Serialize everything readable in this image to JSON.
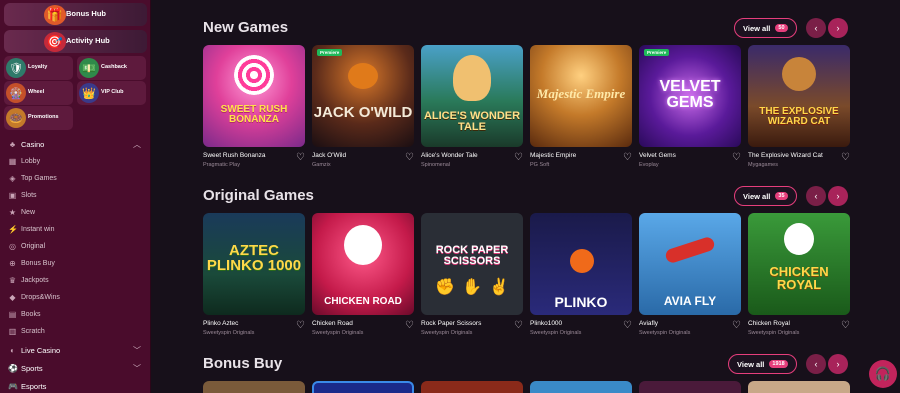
{
  "sidebar": {
    "hubs": [
      {
        "label": "Bonus Hub",
        "icon": "gift-icon"
      },
      {
        "label": "Activity Hub",
        "icon": "target-icon"
      }
    ],
    "tiles": [
      {
        "label": "Loyalty",
        "icon": "shield-icon"
      },
      {
        "label": "Cashback",
        "icon": "cashback-icon"
      },
      {
        "label": "Wheel",
        "icon": "wheel-icon"
      },
      {
        "label": "VIP Club",
        "icon": "vip-icon"
      },
      {
        "label": "Promotions",
        "icon": "promotions-icon"
      }
    ],
    "sections": [
      {
        "label": "Casino",
        "icon": "casino-icon"
      },
      {
        "label": "Live Casino",
        "icon": "live-casino-icon"
      },
      {
        "label": "Sports",
        "icon": "sports-icon"
      },
      {
        "label": "Esports",
        "icon": "esports-icon"
      }
    ],
    "items": [
      {
        "label": "Lobby",
        "icon": "lobby-icon"
      },
      {
        "label": "Top Games",
        "icon": "top-games-icon"
      },
      {
        "label": "Slots",
        "icon": "slots-icon"
      },
      {
        "label": "New",
        "icon": "star-icon"
      },
      {
        "label": "Instant win",
        "icon": "instant-win-icon"
      },
      {
        "label": "Original",
        "icon": "original-icon"
      },
      {
        "label": "Bonus Buy",
        "icon": "bonus-buy-icon"
      },
      {
        "label": "Jackpots",
        "icon": "jackpots-icon"
      },
      {
        "label": "Drops&Wins",
        "icon": "drops-wins-icon"
      },
      {
        "label": "Books",
        "icon": "books-icon"
      },
      {
        "label": "Scratch",
        "icon": "scratch-icon"
      }
    ]
  },
  "sections": [
    {
      "title": "New Games",
      "view_all": "View all",
      "count": "50",
      "games": [
        {
          "name": "Sweet Rush Bonanza",
          "provider": "Pragmatic Play",
          "art": "SWEET RUSH BONANZA",
          "badge": ""
        },
        {
          "name": "Jack O'Wild",
          "provider": "Gamzix",
          "art": "JACK O'WILD",
          "badge": "Premiere"
        },
        {
          "name": "Alice's Wonder Tale",
          "provider": "Spinomenal",
          "art": "ALICE'S WONDER TALE",
          "badge": ""
        },
        {
          "name": "Majestic Empire",
          "provider": "PG Soft",
          "art": "Majestic Empire",
          "badge": ""
        },
        {
          "name": "Velvet Gems",
          "provider": "Evoplay",
          "art": "VELVET GEMS",
          "badge": "Premiere"
        },
        {
          "name": "The Explosive Wizard Cat",
          "provider": "Mygagames",
          "art": "THE EXPLOSIVE WIZARD CAT",
          "badge": ""
        }
      ]
    },
    {
      "title": "Original Games",
      "view_all": "View all",
      "count": "35",
      "games": [
        {
          "name": "Plinko Aztec",
          "provider": "Sweetyspin Originals",
          "art": "AZTEC PLINKO 1000",
          "badge": ""
        },
        {
          "name": "Chicken Road",
          "provider": "Sweetyspin Originals",
          "art": "CHICKEN ROAD",
          "badge": ""
        },
        {
          "name": "Rock Paper Scissors",
          "provider": "Sweetyspin Originals",
          "art": "ROCK PAPER SCISSORS",
          "badge": ""
        },
        {
          "name": "Plinko1000",
          "provider": "Sweetyspin Originals",
          "art": "PLINKO",
          "badge": ""
        },
        {
          "name": "Aviafly",
          "provider": "Sweetyspin Originals",
          "art": "AVIA FLY",
          "badge": ""
        },
        {
          "name": "Chicken Royal",
          "provider": "Sweetyspin Originals",
          "art": "CHICKEN ROYAL",
          "badge": ""
        }
      ]
    },
    {
      "title": "Bonus Buy",
      "view_all": "View all",
      "count": "1918",
      "games": []
    }
  ],
  "support": {
    "icon": "headset-icon"
  },
  "colors": {
    "accent": "#e63e7c",
    "sidebar": "#4a0c2c",
    "background": "#17101a"
  }
}
